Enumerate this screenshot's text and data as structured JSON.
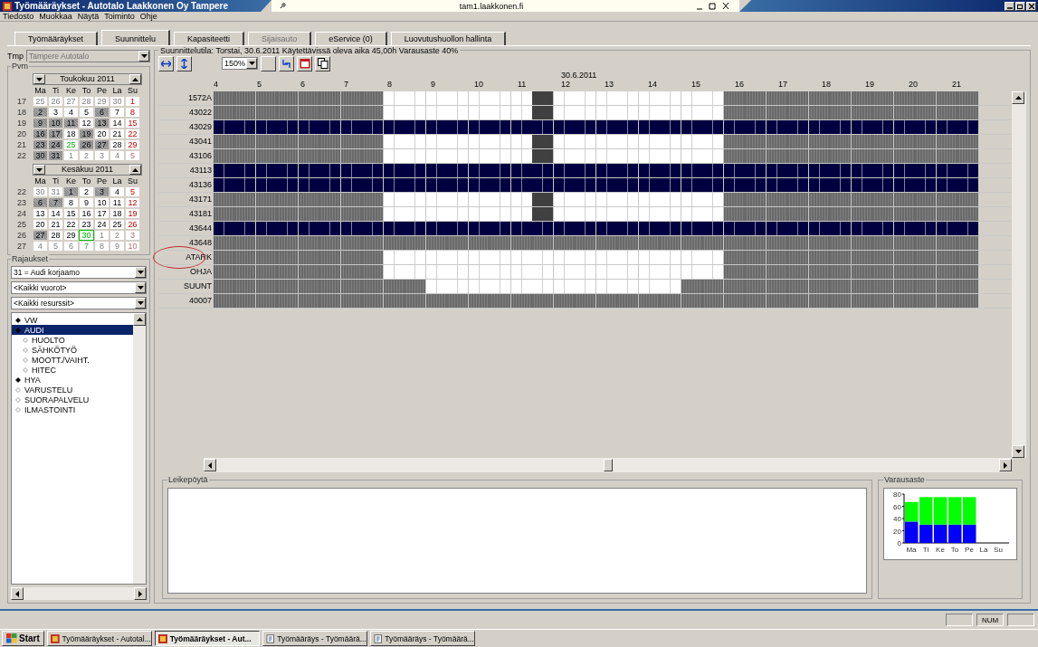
{
  "window": {
    "title": "Työmääräykset - Autotalo Laakkonen Oy Tampere",
    "remote_host": "tam1.laakkonen.fi"
  },
  "menu": [
    "Tiedosto",
    "Muokkaa",
    "Näytä",
    "Toiminto",
    "Ohje"
  ],
  "tabs": [
    {
      "label": "Työmääräykset",
      "selected": false,
      "disabled": false
    },
    {
      "label": "Suunnittelu",
      "selected": true,
      "disabled": false
    },
    {
      "label": "Kapasiteetti",
      "selected": false,
      "disabled": false
    },
    {
      "label": "Sijaisauto",
      "selected": false,
      "disabled": true
    },
    {
      "label": "eService (0)",
      "selected": false,
      "disabled": false
    },
    {
      "label": "Luovutushuollon hallinta",
      "selected": false,
      "disabled": false
    }
  ],
  "left": {
    "tmp_label": "Tmp",
    "tmp_value": "Tampere Autotalo",
    "date_group": "Pvm",
    "calendars": [
      {
        "month": "Toukokuu 2011",
        "weekdays": [
          "Ma",
          "Ti",
          "Ke",
          "To",
          "Pe",
          "La",
          "Su"
        ],
        "weeks": [
          {
            "no": "17",
            "days": [
              {
                "n": "25",
                "kind": "out"
              },
              {
                "n": "26",
                "kind": "out"
              },
              {
                "n": "27",
                "kind": "out"
              },
              {
                "n": "28",
                "kind": "out"
              },
              {
                "n": "29",
                "kind": "out"
              },
              {
                "n": "30",
                "kind": "out"
              },
              {
                "n": "1",
                "kind": "plain"
              }
            ]
          },
          {
            "no": "18",
            "days": [
              {
                "n": "2",
                "kind": "busy"
              },
              {
                "n": "3",
                "kind": "plain"
              },
              {
                "n": "4",
                "kind": "plain"
              },
              {
                "n": "5",
                "kind": "plain"
              },
              {
                "n": "6",
                "kind": "busy"
              },
              {
                "n": "7",
                "kind": "plain"
              },
              {
                "n": "8",
                "kind": "plain"
              }
            ]
          },
          {
            "no": "19",
            "days": [
              {
                "n": "9",
                "kind": "busy"
              },
              {
                "n": "10",
                "kind": "busy"
              },
              {
                "n": "11",
                "kind": "busy"
              },
              {
                "n": "12",
                "kind": "plain"
              },
              {
                "n": "13",
                "kind": "busy"
              },
              {
                "n": "14",
                "kind": "plain"
              },
              {
                "n": "15",
                "kind": "plain"
              }
            ]
          },
          {
            "no": "20",
            "days": [
              {
                "n": "16",
                "kind": "busy"
              },
              {
                "n": "17",
                "kind": "busy"
              },
              {
                "n": "18",
                "kind": "plain"
              },
              {
                "n": "19",
                "kind": "busy"
              },
              {
                "n": "20",
                "kind": "plain"
              },
              {
                "n": "21",
                "kind": "plain"
              },
              {
                "n": "22",
                "kind": "plain"
              }
            ]
          },
          {
            "no": "21",
            "days": [
              {
                "n": "23",
                "kind": "busy"
              },
              {
                "n": "24",
                "kind": "busy"
              },
              {
                "n": "25",
                "kind": "mark"
              },
              {
                "n": "26",
                "kind": "busy"
              },
              {
                "n": "27",
                "kind": "busy"
              },
              {
                "n": "28",
                "kind": "plain"
              },
              {
                "n": "29",
                "kind": "plain"
              }
            ]
          },
          {
            "no": "22",
            "days": [
              {
                "n": "30",
                "kind": "busy"
              },
              {
                "n": "31",
                "kind": "busy"
              },
              {
                "n": "1",
                "kind": "out"
              },
              {
                "n": "2",
                "kind": "out"
              },
              {
                "n": "3",
                "kind": "out"
              },
              {
                "n": "4",
                "kind": "out"
              },
              {
                "n": "5",
                "kind": "out"
              }
            ]
          }
        ]
      },
      {
        "month": "Kesäkuu 2011",
        "weekdays": [
          "Ma",
          "Ti",
          "Ke",
          "To",
          "Pe",
          "La",
          "Su"
        ],
        "weeks": [
          {
            "no": "22",
            "days": [
              {
                "n": "30",
                "kind": "out"
              },
              {
                "n": "31",
                "kind": "out"
              },
              {
                "n": "1",
                "kind": "busy"
              },
              {
                "n": "2",
                "kind": "plain"
              },
              {
                "n": "3",
                "kind": "busy"
              },
              {
                "n": "4",
                "kind": "plain"
              },
              {
                "n": "5",
                "kind": "plain"
              }
            ]
          },
          {
            "no": "23",
            "days": [
              {
                "n": "6",
                "kind": "busy"
              },
              {
                "n": "7",
                "kind": "busy"
              },
              {
                "n": "8",
                "kind": "plain"
              },
              {
                "n": "9",
                "kind": "plain"
              },
              {
                "n": "10",
                "kind": "plain"
              },
              {
                "n": "11",
                "kind": "plain"
              },
              {
                "n": "12",
                "kind": "plain"
              }
            ]
          },
          {
            "no": "24",
            "days": [
              {
                "n": "13",
                "kind": "plain"
              },
              {
                "n": "14",
                "kind": "plain"
              },
              {
                "n": "15",
                "kind": "plain"
              },
              {
                "n": "16",
                "kind": "plain"
              },
              {
                "n": "17",
                "kind": "plain"
              },
              {
                "n": "18",
                "kind": "plain"
              },
              {
                "n": "19",
                "kind": "plain"
              }
            ]
          },
          {
            "no": "25",
            "days": [
              {
                "n": "20",
                "kind": "plain"
              },
              {
                "n": "21",
                "kind": "plain"
              },
              {
                "n": "22",
                "kind": "plain"
              },
              {
                "n": "23",
                "kind": "plain"
              },
              {
                "n": "24",
                "kind": "plain"
              },
              {
                "n": "25",
                "kind": "plain"
              },
              {
                "n": "26",
                "kind": "plain"
              }
            ]
          },
          {
            "no": "26",
            "days": [
              {
                "n": "27",
                "kind": "busy"
              },
              {
                "n": "28",
                "kind": "plain"
              },
              {
                "n": "29",
                "kind": "plain"
              },
              {
                "n": "30",
                "kind": "selected"
              },
              {
                "n": "1",
                "kind": "out"
              },
              {
                "n": "2",
                "kind": "out"
              },
              {
                "n": "3",
                "kind": "out"
              }
            ]
          },
          {
            "no": "27",
            "days": [
              {
                "n": "4",
                "kind": "out"
              },
              {
                "n": "5",
                "kind": "out"
              },
              {
                "n": "6",
                "kind": "out"
              },
              {
                "n": "7",
                "kind": "outmark"
              },
              {
                "n": "8",
                "kind": "out"
              },
              {
                "n": "9",
                "kind": "out"
              },
              {
                "n": "10",
                "kind": "out"
              }
            ]
          }
        ]
      }
    ],
    "filter_group": "Rajaukset",
    "filters": [
      "31 = Audi korjaamo",
      "<Kaikki vuorot>",
      "<Kaikki resurssit>"
    ],
    "tree": [
      {
        "label": "VW",
        "filled": true,
        "selected": false
      },
      {
        "label": "AUDI",
        "filled": true,
        "selected": true,
        "children": [
          {
            "label": "HUOLTO",
            "filled": false,
            "selected": false
          },
          {
            "label": "SÄHKÖTYÖ",
            "filled": false,
            "selected": false
          },
          {
            "label": "MOOTT./VAIHT.",
            "filled": false,
            "selected": false
          },
          {
            "label": "HITEC",
            "filled": false,
            "selected": false
          }
        ]
      },
      {
        "label": "HYA",
        "filled": true,
        "selected": false
      },
      {
        "label": "VARUSTELU",
        "filled": false,
        "selected": false
      },
      {
        "label": "SUORAPALVELU",
        "filled": false,
        "selected": false
      },
      {
        "label": "ILMASTOINTI",
        "filled": false,
        "selected": false
      }
    ]
  },
  "planner": {
    "status": "Suunnittelutila: Torstai, 30.6.2011 Käytettävissä oleva aika 45,00h Varausaste 40%",
    "zoom": "150%",
    "hours": [
      {
        "label": "4"
      },
      {
        "label": "5"
      },
      {
        "label": "6"
      },
      {
        "label": "7"
      },
      {
        "label": "8"
      },
      {
        "label": "9"
      },
      {
        "label": "10"
      },
      {
        "label": "11"
      },
      {
        "label": "12",
        "date": "30.6.2011"
      },
      {
        "label": "13"
      },
      {
        "label": "14"
      },
      {
        "label": "15"
      },
      {
        "label": "16"
      },
      {
        "label": "17"
      },
      {
        "label": "18"
      },
      {
        "label": "19"
      },
      {
        "label": "20"
      },
      {
        "label": "21"
      }
    ],
    "rows": [
      {
        "label": "1572A",
        "kind": "lunch",
        "circled": false
      },
      {
        "label": "43022",
        "kind": "lunch",
        "circled": false
      },
      {
        "label": "43029",
        "kind": "reserved",
        "circled": false
      },
      {
        "label": "43041",
        "kind": "lunch",
        "circled": false
      },
      {
        "label": "43106",
        "kind": "lunch",
        "circled": false
      },
      {
        "label": "43113",
        "kind": "reserved",
        "circled": false
      },
      {
        "label": "43136",
        "kind": "reserved",
        "circled": false
      },
      {
        "label": "43171",
        "kind": "lunch",
        "circled": false
      },
      {
        "label": "43181",
        "kind": "lunch",
        "circled": false
      },
      {
        "label": "43644",
        "kind": "reserved",
        "circled": false
      },
      {
        "label": "43648",
        "kind": "closed",
        "circled": false
      },
      {
        "label": "ATARK",
        "kind": "open",
        "circled": true
      },
      {
        "label": "OHJA",
        "kind": "open",
        "circled": false
      },
      {
        "label": "SUUNT",
        "kind": "short",
        "circled": false
      },
      {
        "label": "40007",
        "kind": "closed",
        "circled": false
      }
    ]
  },
  "clipboard": {
    "title": "Leikepöytä"
  },
  "occupancy": {
    "title": "Varausaste",
    "chart_data": {
      "type": "bar",
      "stacked": true,
      "categories": [
        "Ma",
        "Ti",
        "Ke",
        "To",
        "Pe",
        "La",
        "Su"
      ],
      "series": [
        {
          "color": "#0000ff",
          "values": [
            35,
            30,
            30,
            30,
            30,
            0,
            0
          ]
        },
        {
          "color": "#00ff00",
          "values": [
            32,
            45,
            45,
            45,
            45,
            0,
            0
          ]
        }
      ],
      "ylim": [
        0,
        80
      ],
      "yticks": [
        0,
        20,
        40,
        60,
        80
      ]
    }
  },
  "status_bar": {
    "indicator": "NUM"
  },
  "taskbar": {
    "start": "Start",
    "items": [
      {
        "label": "Työmääräykset - Autotal...",
        "selected": false,
        "kind": "app"
      },
      {
        "label": "Työmääräykset - Aut...",
        "selected": true,
        "kind": "app"
      },
      {
        "label": "Työmääräys - Työmäärä...",
        "selected": false,
        "kind": "doc"
      },
      {
        "label": "Työmääräys - Työmäärä...",
        "selected": false,
        "kind": "doc"
      }
    ]
  }
}
